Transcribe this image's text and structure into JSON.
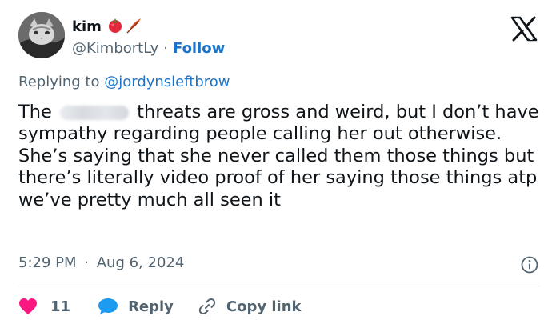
{
  "user": {
    "name": "kim",
    "handle": "@KimbortLy",
    "separator": "·",
    "follow_label": "Follow",
    "emojis": [
      "tomato-emoji",
      "feather-emoji"
    ]
  },
  "brand_logo": "x-logo",
  "reply_context": {
    "prefix": "Replying to",
    "mention": "@jordynsleftbrow"
  },
  "tweet": {
    "text_start": "The",
    "redacted": true,
    "text_rest": "threats are gross and weird, but I don’t have sympathy regarding people calling her out otherwise. She’s saying that she never called them those things but there’s literally video proof of her saying those things atp we’ve pretty much all seen it"
  },
  "meta": {
    "time": "5:29 PM",
    "separator": "·",
    "date": "Aug 6, 2024"
  },
  "actions": {
    "likes": "11",
    "reply_label": "Reply",
    "copy_link_label": "Copy link"
  },
  "colors": {
    "link": "#1d73c7",
    "like": "#f91880",
    "reply_icon": "#1d9bf0",
    "muted": "#536471",
    "text": "#0f1419"
  }
}
